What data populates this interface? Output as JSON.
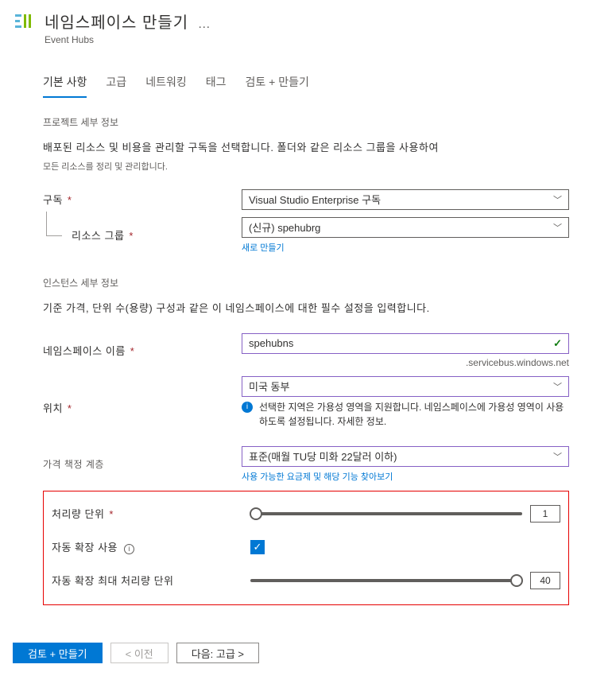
{
  "header": {
    "title": "네임스페이스 만들기",
    "more": "…",
    "subtitle": "Event Hubs"
  },
  "tabs": [
    {
      "label": "기본 사항",
      "active": true
    },
    {
      "label": "고급",
      "active": false
    },
    {
      "label": "네트워킹",
      "active": false
    },
    {
      "label": "태그",
      "active": false
    },
    {
      "label": "검토 + 만들기",
      "active": false
    }
  ],
  "project": {
    "section_title": "프로젝트 세부 정보",
    "desc": "배포된 리소스 및 비용을 관리할 구독을 선택합니다. 폴더와 같은 리소스 그룹을 사용하여",
    "desc_sub": "모든 리소스를 정리 및 관리합니다.",
    "subscription_label": "구독",
    "subscription_value": "Visual Studio Enterprise 구독",
    "resource_group_label": "리소스 그룹",
    "resource_group_value": "(신규) spehubrg",
    "create_new_link": "새로 만들기"
  },
  "instance": {
    "section_title": "인스턴스 세부 정보",
    "desc": "기준 가격, 단위 수(용량) 구성과 같은 이 네임스페이스에 대한 필수 설정을 입력합니다.",
    "namespace_label": "네임스페이스 이름",
    "namespace_value": "spehubns",
    "namespace_suffix": ".servicebus.windows.net",
    "location_label": "위치",
    "location_value": "미국 동부",
    "location_info": "선택한 지역은 가용성 영역을 지원합니다. 네임스페이스에 가용성 영역이 사용하도록 설정됩니다. 자세한 정보.",
    "pricing_label": "가격 책정 계층",
    "pricing_value": "표준(매월 TU당 미화 22달러 이하)",
    "pricing_link": "사용 가능한 요금제 및 해당 기능 찾아보기"
  },
  "throughput": {
    "units_label": "처리량 단위",
    "units_value": "1",
    "auto_inflate_label": "자동 확장 사용",
    "auto_inflate_checked": true,
    "max_units_label": "자동 확장 최대 처리량 단위",
    "max_units_value": "40"
  },
  "footer": {
    "review": "검토 + 만들기",
    "previous": "< 이전",
    "next": "다음: 고급 >"
  }
}
